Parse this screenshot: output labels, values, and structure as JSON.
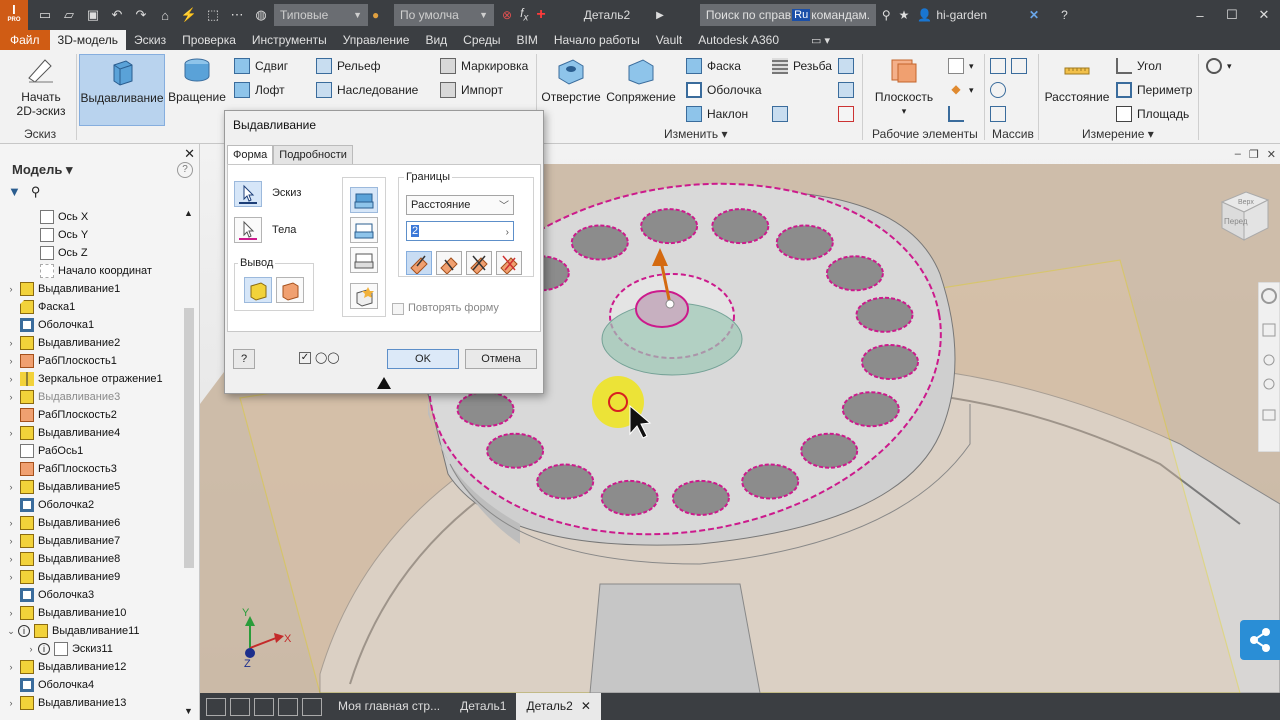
{
  "app": {
    "logo": "I",
    "logo_sub": "PRO",
    "style_combo": "Типовые",
    "material_combo": "По умолча",
    "document_title": "Деталь2",
    "search_placeholder": "Поиск по справ",
    "search_suffix": "командам.",
    "search_badge": "Ru",
    "user": "hi-garden"
  },
  "menu": {
    "tabs": [
      "Файл",
      "3D-модель",
      "Эскиз",
      "Проверка",
      "Инструменты",
      "Управление",
      "Вид",
      "Среды",
      "BIM",
      "Начало работы",
      "Vault",
      "Autodesk A360"
    ],
    "active": "3D-модель"
  },
  "ribbon": {
    "sketch_btn": "Начать\n2D-эскиз",
    "sketch_line1": "Начать",
    "sketch_line2": "2D-эскиз",
    "extrude_btn": "Выдавливание",
    "revolve_btn": "Вращение",
    "shift": "Сдвиг",
    "loft": "Лофт",
    "emboss": "Рельеф",
    "derive": "Наследование",
    "mark": "Маркировка",
    "import": "Импорт",
    "hole": "Отверстие",
    "fillet": "Сопряжение",
    "chamfer": "Фаска",
    "shell": "Оболочка",
    "draft": "Наклон",
    "thread": "Резьба",
    "plane": "Плоскость",
    "distance": "Расстояние",
    "angle": "Угол",
    "perimeter": "Периметр",
    "area": "Площадь",
    "groups": {
      "sketch": "Эскиз",
      "modify": "Изменить",
      "work_features": "Рабочие элементы",
      "pattern": "Массив",
      "measure": "Измерение"
    }
  },
  "panel": {
    "title": "Модель",
    "tree": [
      {
        "label": "Ось X",
        "icon": "axis",
        "level": 2
      },
      {
        "label": "Ось Y",
        "icon": "axis",
        "level": 2
      },
      {
        "label": "Ось Z",
        "icon": "axis",
        "level": 2
      },
      {
        "label": "Начало координат",
        "icon": "origin",
        "level": 2
      },
      {
        "label": "Выдавливание1",
        "icon": "extrude",
        "level": 1,
        "expandable": true
      },
      {
        "label": "Фаска1",
        "icon": "chamfer",
        "level": 1
      },
      {
        "label": "Оболочка1",
        "icon": "shell",
        "level": 1
      },
      {
        "label": "Выдавливание2",
        "icon": "extrude",
        "level": 1,
        "expandable": true
      },
      {
        "label": "РабПлоскость1",
        "icon": "plane",
        "level": 1,
        "expandable": true
      },
      {
        "label": "Зеркальное отражение1",
        "icon": "mirror",
        "level": 1,
        "expandable": true
      },
      {
        "label": "Выдавливание3",
        "icon": "extrude",
        "level": 1,
        "expandable": true,
        "dim": true
      },
      {
        "label": "РабПлоскость2",
        "icon": "plane",
        "level": 1
      },
      {
        "label": "Выдавливание4",
        "icon": "extrude",
        "level": 1,
        "expandable": true
      },
      {
        "label": "РабОсь1",
        "icon": "axis",
        "level": 1
      },
      {
        "label": "РабПлоскость3",
        "icon": "plane",
        "level": 1
      },
      {
        "label": "Выдавливание5",
        "icon": "extrude",
        "level": 1,
        "expandable": true
      },
      {
        "label": "Оболочка2",
        "icon": "shell",
        "level": 1
      },
      {
        "label": "Выдавливание6",
        "icon": "extrude",
        "level": 1,
        "expandable": true
      },
      {
        "label": "Выдавливание7",
        "icon": "extrude",
        "level": 1,
        "expandable": true
      },
      {
        "label": "Выдавливание8",
        "icon": "extrude",
        "level": 1,
        "expandable": true
      },
      {
        "label": "Выдавливание9",
        "icon": "extrude",
        "level": 1,
        "expandable": true
      },
      {
        "label": "Оболочка3",
        "icon": "shell",
        "level": 1
      },
      {
        "label": "Выдавливание10",
        "icon": "extrude",
        "level": 1,
        "expandable": true
      },
      {
        "label": "Выдавливание11",
        "icon": "extrude-info",
        "level": 1,
        "expanded": true
      },
      {
        "label": "Эскиз11",
        "icon": "sketch-info",
        "level": 2,
        "expandable": true
      },
      {
        "label": "Выдавливание12",
        "icon": "extrude",
        "level": 1,
        "expandable": true
      },
      {
        "label": "Оболочка4",
        "icon": "shell",
        "level": 1
      },
      {
        "label": "Выдавливание13",
        "icon": "extrude",
        "level": 1,
        "expandable": true
      }
    ]
  },
  "dialog": {
    "title": "Выдавливание",
    "tabs": [
      "Форма",
      "Подробности"
    ],
    "sketch_label": "Эскиз",
    "solids_label": "Тела",
    "output_group": "Вывод",
    "extents_group": "Границы",
    "extent_type": "Расстояние",
    "distance_value": "2",
    "repeat_shape": "Повторять форму",
    "ok": "OK",
    "cancel": "Отмена",
    "help": "?"
  },
  "view_tabs": [
    "Моя главная стр...",
    "Деталь1",
    "Деталь2"
  ],
  "view_active": "Деталь2",
  "navcube": {
    "top": "Верх",
    "front": "Перед"
  },
  "triad": {
    "x": "X",
    "y": "Y",
    "z": "Z"
  },
  "colors": {
    "accent_orange": "#d05c14",
    "selection_blue": "#b9d3ee",
    "edge_magenta": "#cc1a8c",
    "highlight_yellow": "#f2e600"
  }
}
